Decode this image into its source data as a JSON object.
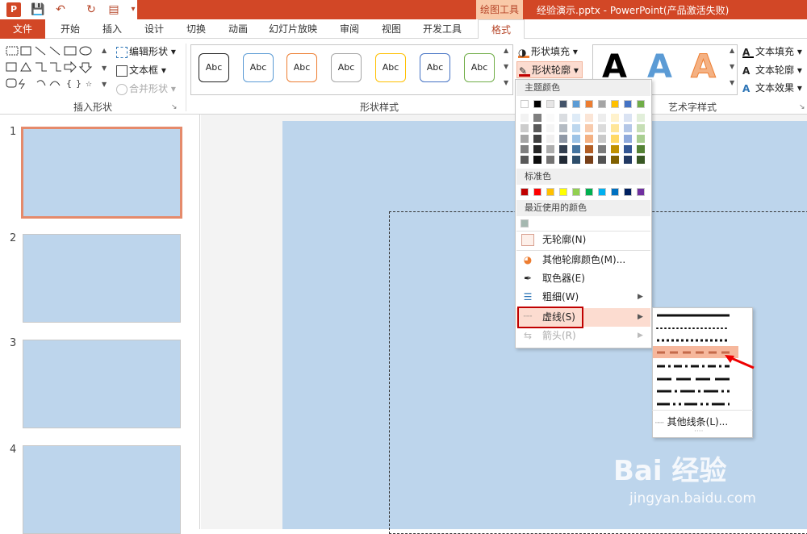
{
  "titlebar": {
    "drawing_tools": "绘图工具",
    "title": "经验演示.pptx - PowerPoint(产品激活失败)",
    "logo": "P"
  },
  "tabs": [
    "开始",
    "插入",
    "设计",
    "切换",
    "动画",
    "幻灯片放映",
    "审阅",
    "视图",
    "开发工具"
  ],
  "tab_file": "文件",
  "tab_format": "格式",
  "ribbon": {
    "edit_shape": "编辑形状",
    "textbox": "文本框",
    "merge_shapes": "合并形状",
    "group_insert_shapes": "插入形状",
    "group_shape_styles": "形状样式",
    "group_wordart": "艺术字样式",
    "shape_fill": "形状填充",
    "shape_outline": "形状轮廓",
    "text_fill": "文本填充",
    "text_outline": "文本轮廓",
    "text_effect": "文本效果",
    "abc": "Abc",
    "wordart_letter": "A"
  },
  "abc_border_colors": [
    "#222222",
    "#5b9bd5",
    "#ed7d31",
    "#a5a5a5",
    "#ffc000",
    "#4472c4",
    "#70ad47"
  ],
  "slides": [
    "1",
    "2",
    "3",
    "4"
  ],
  "menu": {
    "theme_colors": "主题颜色",
    "standard_colors": "标准色",
    "recent_colors": "最近使用的颜色",
    "no_outline": "无轮廓(N)",
    "more_colors": "其他轮廓颜色(M)...",
    "eyedropper": "取色器(E)",
    "weight": "粗细(W)",
    "dashes": "虚线(S)",
    "arrows": "箭头(R)"
  },
  "theme_top": [
    "#ffffff",
    "#000000",
    "#e7e6e6",
    "#44546a",
    "#5b9bd5",
    "#ed7d31",
    "#a5a5a5",
    "#ffc000",
    "#4472c4",
    "#70ad47"
  ],
  "standard": [
    "#c00000",
    "#ff0000",
    "#ffc000",
    "#ffff00",
    "#92d050",
    "#00b050",
    "#00b0f0",
    "#0070c0",
    "#002060",
    "#7030a0"
  ],
  "recent": [
    "#a5b8b0"
  ],
  "submenu": {
    "more_lines": "其他线条(L)..."
  },
  "watermark": {
    "brand": "Bai 经验",
    "url": "jingyan.baidu.com"
  }
}
